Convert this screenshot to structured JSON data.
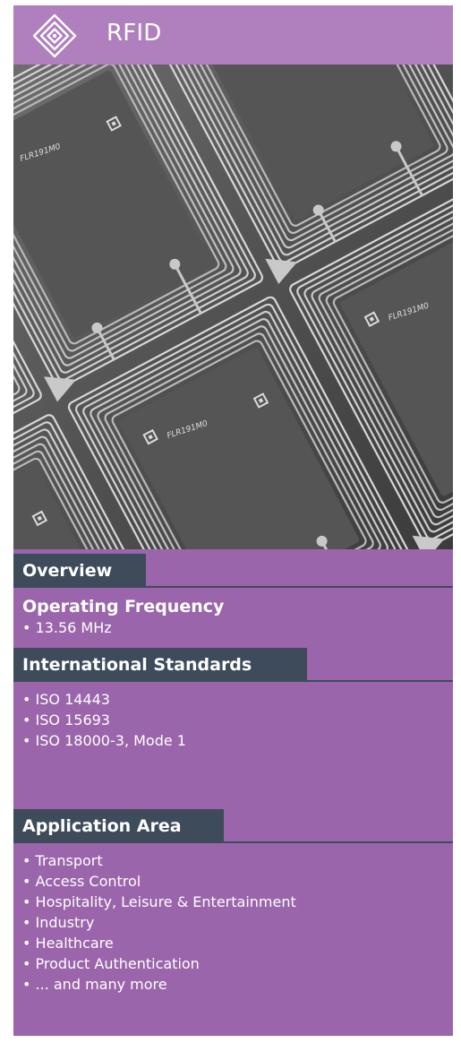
{
  "header": {
    "title": "RFID",
    "logo_icon": "concentric-diamond-logo-icon"
  },
  "photo": {
    "subject": "rfid-inlay-antenna-sheet",
    "label_text": "FLR191M0"
  },
  "overview": {
    "tab_label": "Overview",
    "frequency": {
      "heading": "Operating Frequency",
      "items": [
        "13.56 MHz"
      ]
    }
  },
  "standards": {
    "tab_label": "International Standards",
    "items": [
      "ISO 14443",
      "ISO 15693",
      "ISO 18000-3, Mode 1"
    ]
  },
  "applications": {
    "tab_label": "Application Area",
    "items": [
      "Transport",
      "Access Control",
      "Hospitality, Leisure & Entertainment",
      "Industry",
      "Healthcare",
      "Product Authentication",
      "... and many more"
    ]
  },
  "colors": {
    "card_bg": "#9a65aa",
    "header_bg": "#b07fbe",
    "tab_bg": "#3e4b5b",
    "text": "#ffffff"
  }
}
